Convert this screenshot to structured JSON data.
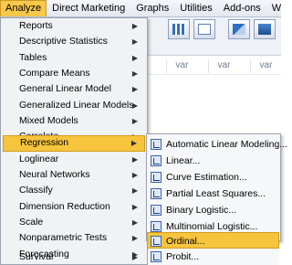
{
  "menubar": {
    "items": [
      "Analyze",
      "Direct Marketing",
      "Graphs",
      "Utilities",
      "Add-ons",
      "Window",
      "He"
    ]
  },
  "grid": {
    "col_headers": [
      "var",
      "var",
      "var"
    ]
  },
  "analyze_menu": {
    "items": [
      "Reports",
      "Descriptive Statistics",
      "Tables",
      "Compare Means",
      "General Linear Model",
      "Generalized Linear Models",
      "Mixed Models",
      "Correlate",
      "Regression",
      "Loglinear",
      "Neural Networks",
      "Classify",
      "Dimension Reduction",
      "Scale",
      "Nonparametric Tests",
      "Forecasting",
      "Survival"
    ],
    "highlighted": "Regression"
  },
  "regression_menu": {
    "items": [
      "Automatic Linear Modeling...",
      "Linear...",
      "Curve Estimation...",
      "Partial Least Squares...",
      "Binary Logistic...",
      "Multinomial Logistic...",
      "Ordinal...",
      "Probit..."
    ],
    "highlighted": "Ordinal..."
  },
  "colors": {
    "highlight": "#f6c53d",
    "menu_bg": "#f1f2f4",
    "menubar_bg": "#e3e8f1"
  }
}
